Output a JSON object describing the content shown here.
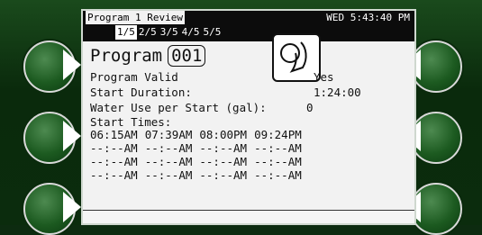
{
  "titlebar": {
    "left": "Program 1 Review",
    "right": "WED 5:43:40 PM"
  },
  "tabs": [
    "1/5",
    "2/5",
    "3/5",
    "4/5",
    "5/5"
  ],
  "program": {
    "title": "Program",
    "number": "001"
  },
  "fields": [
    {
      "label": "Program Valid",
      "value": "Yes"
    },
    {
      "label": "Start Duration:",
      "value": "1:24:00"
    },
    {
      "label": "Water Use per Start (gal):",
      "value": "0"
    }
  ],
  "start_times_label": "Start Times:",
  "start_times": [
    [
      "06:15AM",
      "07:39AM",
      "08:00PM",
      "09:24PM"
    ],
    [
      "--:--AM",
      "--:--AM",
      "--:--AM",
      "--:--AM"
    ],
    [
      "--:--AM",
      "--:--AM",
      "--:--AM",
      "--:--AM"
    ],
    [
      "--:--AM",
      "--:--AM",
      "--:--AM",
      "--:--AM"
    ]
  ],
  "colors": {
    "bezel": "#0d2b10",
    "button": "#1c5a20",
    "screen": "#f2f2f2"
  }
}
